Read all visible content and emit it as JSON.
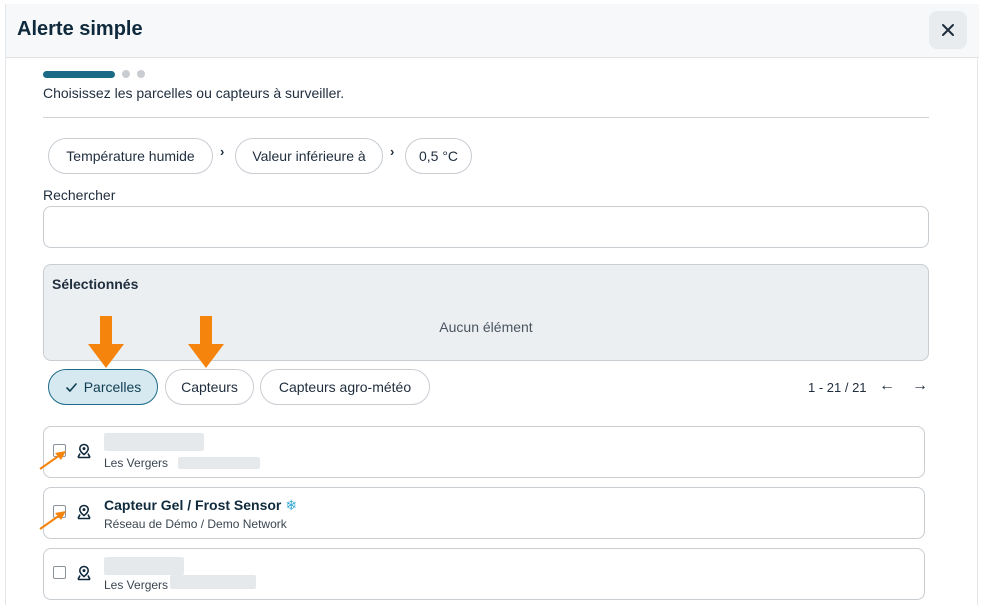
{
  "dialog": {
    "title": "Alerte simple",
    "close_icon": "close-icon"
  },
  "steps": {
    "current": 1,
    "total": 3
  },
  "instruction": "Choisissez les parcelles ou capteurs à surveiller.",
  "condition": {
    "measure": "Température humide",
    "operator": "Valeur inférieure à",
    "threshold": "0,5 °C"
  },
  "search": {
    "label": "Rechercher",
    "value": "",
    "placeholder": ""
  },
  "selected": {
    "title": "Sélectionnés",
    "empty_text": "Aucun élément"
  },
  "filters": [
    {
      "label": "Parcelles",
      "active": true
    },
    {
      "label": "Capteurs",
      "active": false
    },
    {
      "label": "Capteurs agro-météo",
      "active": false
    }
  ],
  "pagination": {
    "range": "1 - 21 / 21",
    "prev_icon": "arrow-left-icon",
    "next_icon": "arrow-right-icon"
  },
  "items": [
    {
      "name": "",
      "subtitle": "Les Vergers",
      "icon": "map-pin-icon"
    },
    {
      "name": "Capteur Gel / Frost Sensor",
      "subtitle": "Réseau de Démo / Demo Network",
      "icon": "map-pin-icon",
      "badge_icon": "snowflake-icon"
    },
    {
      "name": "",
      "subtitle": "Les Vergers",
      "icon": "map-pin-icon"
    }
  ],
  "colors": {
    "accent": "#1c6b86",
    "annotation_arrow": "#f5840c",
    "snowflake": "#37a9d4"
  }
}
